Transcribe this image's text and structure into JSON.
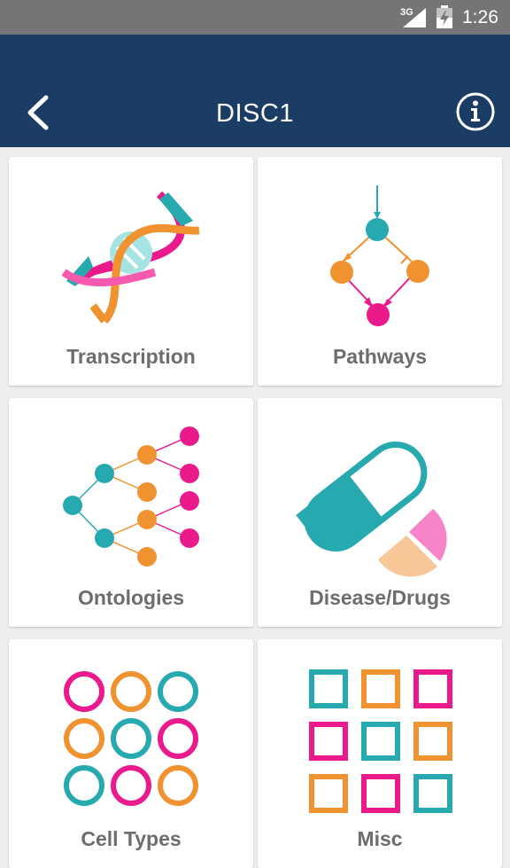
{
  "status_bar": {
    "network": "3G",
    "time": "1:26",
    "icons": [
      "signal-icon",
      "battery-icon"
    ]
  },
  "header": {
    "title": "DISC1",
    "back_icon": "chevron-left-icon",
    "info_icon": "info-icon"
  },
  "tiles": [
    {
      "label": "Transcription",
      "icon": "dna-icon"
    },
    {
      "label": "Pathways",
      "icon": "pathway-icon"
    },
    {
      "label": "Ontologies",
      "icon": "tree-icon"
    },
    {
      "label": "Disease/Drugs",
      "icon": "pill-icon"
    },
    {
      "label": "Cell Types",
      "icon": "circles-grid-icon"
    },
    {
      "label": "Misc",
      "icon": "squares-grid-icon"
    }
  ],
  "colors": {
    "app_bar": "#1b3c64",
    "status_bar": "#757575",
    "background": "#eeeef1",
    "teal": "#27a9b0",
    "orange": "#ef922f",
    "pink": "#ea1a8c",
    "label": "#6d6d6d"
  }
}
